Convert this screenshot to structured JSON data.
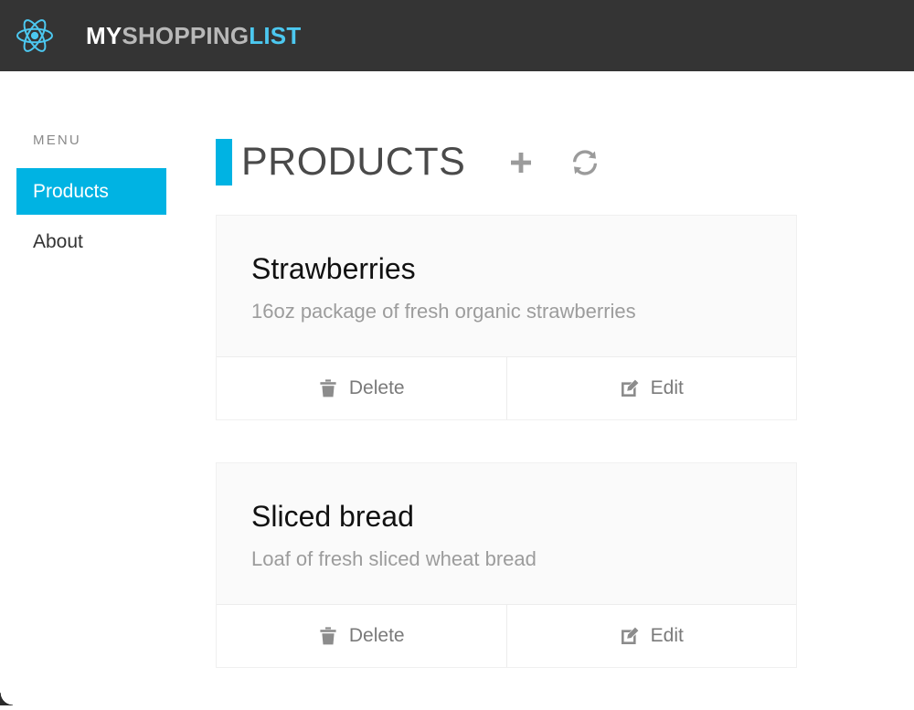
{
  "navbar": {
    "logo_icon": "react-atom-logo",
    "brand": {
      "part1": "MY",
      "part2": "SHOPPING",
      "part3": "LIST"
    },
    "background_color": "#343434",
    "accent_color": "#4cc8f0"
  },
  "sidebar": {
    "heading": "MENU",
    "items": [
      {
        "label": "Products",
        "active": true
      },
      {
        "label": "About",
        "active": false
      }
    ],
    "active_color": "#00b3e3"
  },
  "main": {
    "page_title": "PRODUCTS",
    "accent_color": "#00b3e3",
    "actions": [
      {
        "name": "add-product",
        "icon": "plus-icon",
        "label": "+"
      },
      {
        "name": "refresh-products",
        "icon": "refresh-icon",
        "label": ""
      }
    ]
  },
  "products": [
    {
      "title": "Strawberries",
      "description": "16oz package of fresh organic strawberries",
      "actions": [
        {
          "label": "Delete",
          "icon": "trash-icon"
        },
        {
          "label": "Edit",
          "icon": "edit-pencil-icon"
        }
      ]
    },
    {
      "title": "Sliced bread",
      "description": "Loaf of fresh sliced wheat bread",
      "actions": [
        {
          "label": "Delete",
          "icon": "trash-icon"
        },
        {
          "label": "Edit",
          "icon": "edit-pencil-icon"
        }
      ]
    }
  ]
}
